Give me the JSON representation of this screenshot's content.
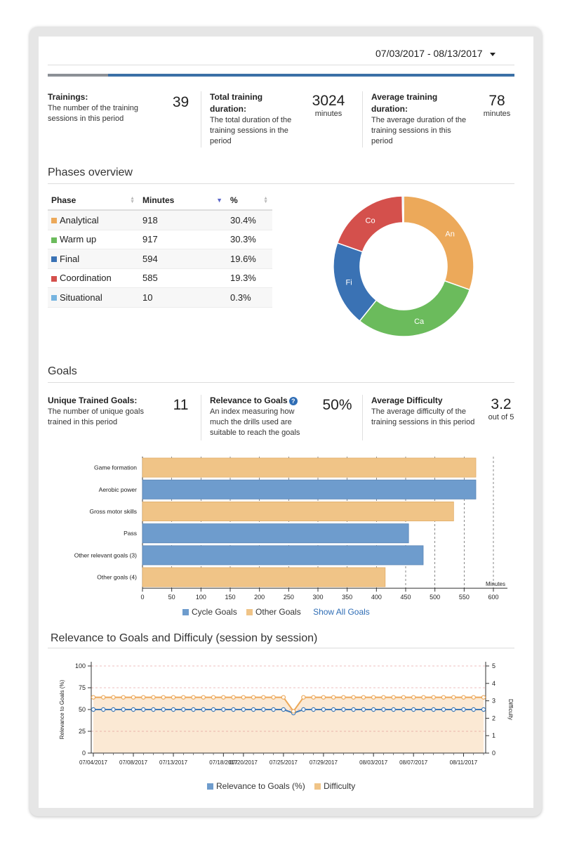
{
  "header": {
    "date_range": "07/03/2017 - 08/13/2017"
  },
  "colors": {
    "accent_blue": "#3b70a6",
    "progress_gray": "#8c9096",
    "orange": "#eca95a",
    "green": "#6bbb5c",
    "blue": "#3a72b4",
    "red": "#d4504c",
    "light_blue": "#76b4e0",
    "bar_blue": "#6e9ccd",
    "bar_orange": "#f0c487"
  },
  "progress": {
    "fraction": 0.13
  },
  "stats": [
    {
      "title": "Trainings:",
      "desc": "The number of the training sessions in this period",
      "value": "39",
      "unit": ""
    },
    {
      "title": "Total training duration:",
      "desc": "The total duration of the training sessions in the period",
      "value": "3024",
      "unit": "minutes"
    },
    {
      "title": "Average training duration:",
      "desc": "The average duration of the training sessions in this period",
      "value": "78",
      "unit": "minutes"
    }
  ],
  "phases": {
    "title": "Phases overview",
    "columns": [
      "Phase",
      "Minutes",
      "%"
    ],
    "rows": [
      {
        "phase": "Analytical",
        "minutes": "918",
        "pct": "30.4%",
        "color": "#eca95a"
      },
      {
        "phase": "Warm up",
        "minutes": "917",
        "pct": "30.3%",
        "color": "#6bbb5c"
      },
      {
        "phase": "Final",
        "minutes": "594",
        "pct": "19.6%",
        "color": "#3a72b4"
      },
      {
        "phase": "Coordination",
        "minutes": "585",
        "pct": "19.3%",
        "color": "#d4504c"
      },
      {
        "phase": "Situational",
        "minutes": "10",
        "pct": "0.3%",
        "color": "#76b4e0"
      }
    ]
  },
  "goals": {
    "title": "Goals",
    "stats": [
      {
        "title": "Unique Trained Goals:",
        "desc": "The number of unique goals trained in this period",
        "value": "11",
        "unit": ""
      },
      {
        "title": "Relevance to Goals",
        "desc": "An index measuring how much the drills used are suitable to reach the goals",
        "value": "50%",
        "unit": ""
      },
      {
        "title": "Average Difficulty",
        "desc": "The average difficulty of the training sessions in this period",
        "value": "3.2",
        "unit": "out of 5"
      }
    ],
    "legend": {
      "cycle": "Cycle Goals",
      "other": "Other Goals",
      "show_all": "Show All Goals"
    }
  },
  "relevance": {
    "title": "Relevance to Goals and Difficuly (session by session)",
    "legend": {
      "relevance": "Relevance to Goals (%)",
      "difficulty": "Difficulty"
    }
  },
  "chart_data": [
    {
      "type": "pie",
      "labels": [
        "An",
        "Ca",
        "Fi",
        "Co",
        ""
      ],
      "values": [
        30.4,
        30.3,
        19.6,
        19.3,
        0.3
      ],
      "colors": [
        "#eca95a",
        "#6bbb5c",
        "#3a72b4",
        "#d4504c",
        "#76b4e0"
      ]
    },
    {
      "type": "bar",
      "orientation": "horizontal",
      "categories": [
        "Game formation",
        "Aerobic power",
        "Gross motor skills",
        "Pass",
        "Other relevant goals (3)",
        "Other goals (4)"
      ],
      "values": [
        570,
        570,
        532,
        455,
        480,
        415
      ],
      "groups": [
        "Other Goals",
        "Cycle Goals",
        "Other Goals",
        "Cycle Goals",
        "Cycle Goals",
        "Other Goals"
      ],
      "xlabel": "Minutes",
      "xlim": [
        0,
        600
      ],
      "xticks": [
        "0",
        "50",
        "100",
        "150",
        "200",
        "250",
        "300",
        "350",
        "400",
        "450",
        "500",
        "550",
        "600"
      ]
    },
    {
      "type": "line",
      "x_ticks": [
        "07/04/2017",
        "07/08/2017",
        "07/13/2017",
        "07/18/2017",
        "07/20/2017",
        "07/25/2017",
        "07/29/2017",
        "08/03/2017",
        "08/07/2017",
        "08/11/2017"
      ],
      "ylabel": "Relevance to Goals (%)",
      "y2label": "Difficulty",
      "ylim": [
        0,
        100
      ],
      "yticks": [
        "0",
        "25",
        "50",
        "75",
        "100"
      ],
      "y2lim": [
        0,
        5
      ],
      "y2ticks": [
        "0",
        "1",
        "2",
        "3",
        "4",
        "5"
      ],
      "series": [
        {
          "name": "Relevance to Goals (%)",
          "values": [
            50,
            50,
            50,
            50,
            50,
            50,
            50,
            50,
            50,
            50,
            50,
            50,
            50,
            50,
            50,
            50,
            50,
            50,
            50,
            50,
            46,
            50,
            50,
            50,
            50,
            50,
            50,
            50,
            50,
            50,
            50,
            50,
            50,
            50,
            50,
            50,
            50,
            50,
            50,
            50
          ]
        },
        {
          "name": "Difficulty",
          "values": [
            3.2,
            3.2,
            3.2,
            3.2,
            3.2,
            3.2,
            3.2,
            3.2,
            3.2,
            3.2,
            3.2,
            3.2,
            3.2,
            3.2,
            3.2,
            3.2,
            3.2,
            3.2,
            3.2,
            3.2,
            2.4,
            3.2,
            3.2,
            3.2,
            3.2,
            3.2,
            3.2,
            3.2,
            3.2,
            3.2,
            3.2,
            3.2,
            3.2,
            3.2,
            3.2,
            3.2,
            3.2,
            3.2,
            3.2,
            3.2
          ]
        }
      ]
    }
  ]
}
